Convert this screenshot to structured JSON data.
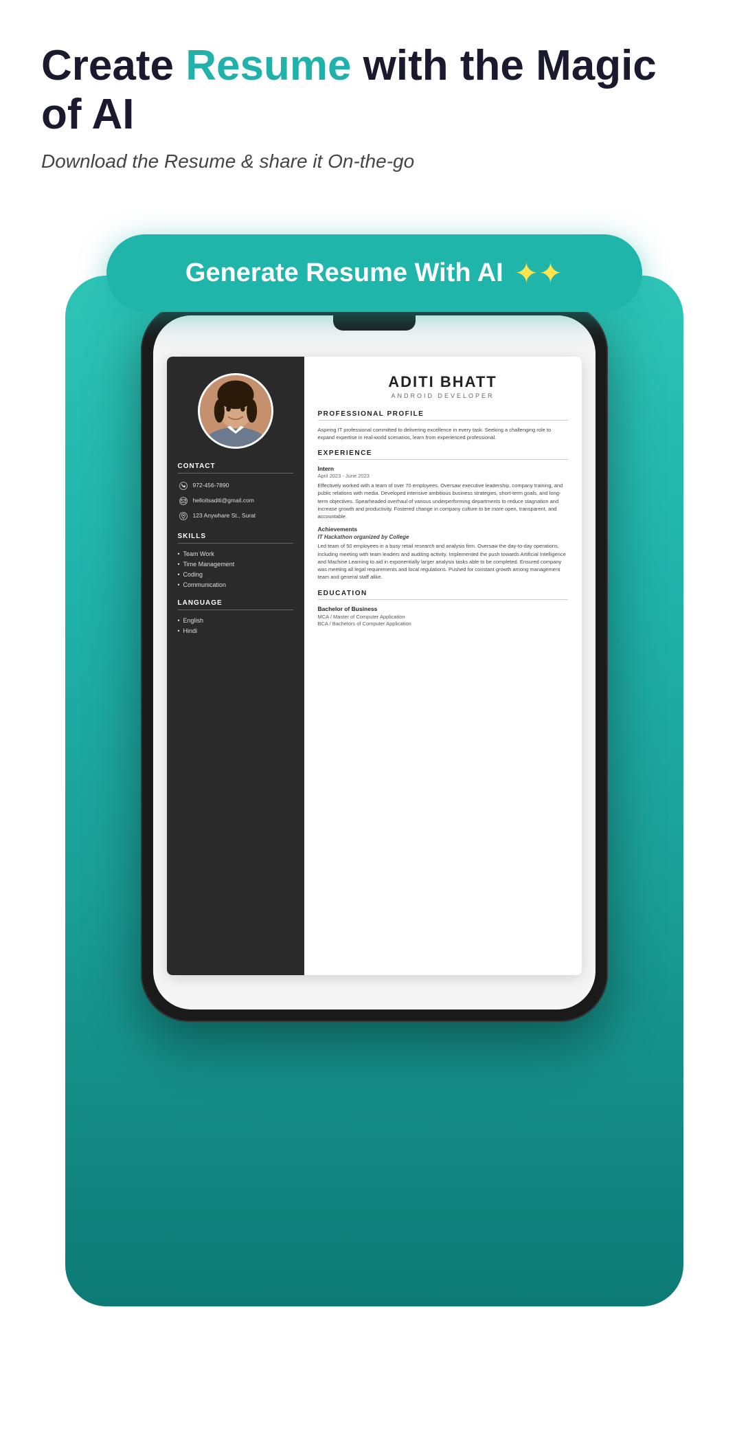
{
  "header": {
    "title_part1": "Create ",
    "title_highlight": "Resume",
    "title_part2": " with the Magic of AI",
    "subtitle": "Download the Resume & share it On-the-go"
  },
  "cta_button": {
    "label": "Generate Resume With AI",
    "icon": "✦"
  },
  "resume": {
    "name": "ADITI BHATT",
    "job_title": "ANDROID DEVELOPER",
    "contact": {
      "section_title": "CONTACT",
      "phone": "972-456-7890",
      "email": "helloitsaditi@gmail.com",
      "address": "123 Anywhare St., Surat"
    },
    "skills": {
      "section_title": "SKILLS",
      "items": [
        "Team Work",
        "Time Management",
        "Coding",
        "Communication"
      ]
    },
    "language": {
      "section_title": "LANGUAGE",
      "items": [
        "English",
        "Hindi"
      ]
    },
    "professional_profile": {
      "heading": "PROFESSIONAL PROFILE",
      "text": "Aspiring IT professional committed to delivering excellence in every task. Seeking a challenging role to expand expertise in real-world scenarios, learn from experienced professional."
    },
    "experience": {
      "heading": "EXPERIENCE",
      "role": "Intern",
      "dates": "April 2023 - June 2023",
      "description": "Effectively worked with a team of over 70 employees. Oversaw executive leadership, company training, and public relations with media. Developed intensive ambitious business strategies, short-term goals, and long-term objectives. Spearheaded overhaul of various underperforming departments to reduce stagnation and increase growth and productivity. Fostered change in company culture to be more open, transparent, and accountable.",
      "achievements_label": "Achievements",
      "achievement_title": "IT Hackathon organized by College",
      "achievement_text": "Led team of 50 employees in a busy retail research and analysis firm. Oversaw the day-to-day operations, including meeting with team leaders and auditing activity. Implemented the push towards Artificial Intelligence and Machine Learning to aid in exponentially larger analysis tasks able to be completed. Ensured company was meeting all legal requirements and local regulations. Pushed for constant growth among management team and general staff alike."
    },
    "education": {
      "heading": "EDUCATION",
      "degree": "Bachelor of Business",
      "programs": [
        "MCA / Master of Computer Application",
        "BCA / Bachelors of Computer Application"
      ]
    }
  }
}
